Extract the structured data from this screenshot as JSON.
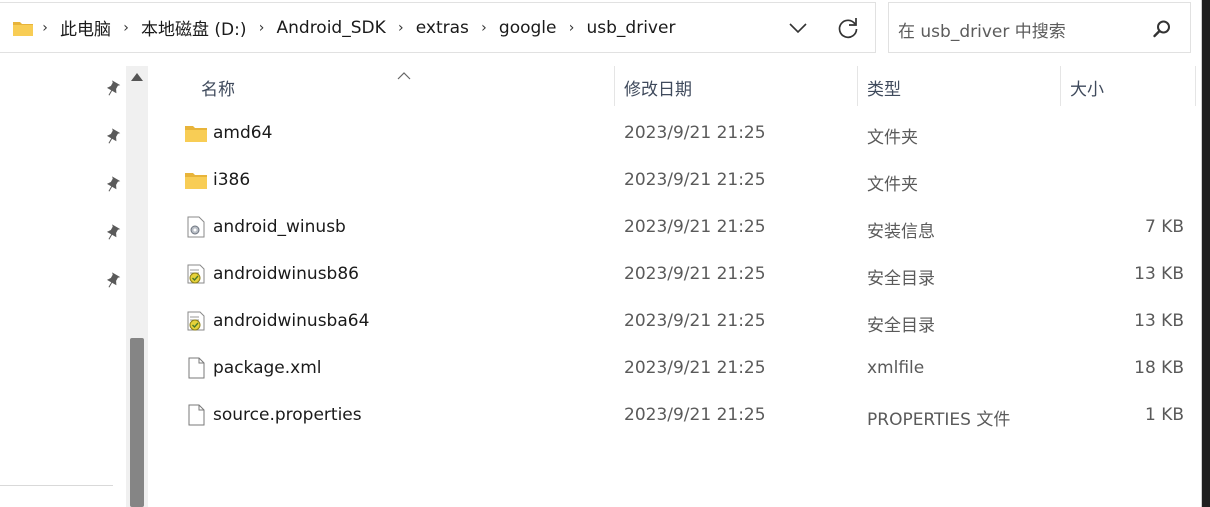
{
  "address_bar": {
    "breadcrumbs": [
      "此电脑",
      "本地磁盘 (D:)",
      "Android_SDK",
      "extras",
      "google",
      "usb_driver"
    ],
    "separator": "›"
  },
  "search": {
    "placeholder": "在 usb_driver 中搜索"
  },
  "columns": {
    "name": "名称",
    "modified": "修改日期",
    "type": "类型",
    "size": "大小"
  },
  "files": [
    {
      "name": "amd64",
      "modified": "2023/9/21 21:25",
      "type": "文件夹",
      "size": "",
      "icon": "folder-icon"
    },
    {
      "name": "i386",
      "modified": "2023/9/21 21:25",
      "type": "文件夹",
      "size": "",
      "icon": "folder-icon"
    },
    {
      "name": "android_winusb",
      "modified": "2023/9/21 21:25",
      "type": "安装信息",
      "size": "7 KB",
      "icon": "setup-info-icon"
    },
    {
      "name": "androidwinusb86",
      "modified": "2023/9/21 21:25",
      "type": "安全目录",
      "size": "13 KB",
      "icon": "security-catalog-icon"
    },
    {
      "name": "androidwinusba64",
      "modified": "2023/9/21 21:25",
      "type": "安全目录",
      "size": "13 KB",
      "icon": "security-catalog-icon"
    },
    {
      "name": "package.xml",
      "modified": "2023/9/21 21:25",
      "type": "xmlfile",
      "size": "18 KB",
      "icon": "document-icon"
    },
    {
      "name": "source.properties",
      "modified": "2023/9/21 21:25",
      "type": "PROPERTIES 文件",
      "size": "1 KB",
      "icon": "document-icon"
    }
  ],
  "colors": {
    "folder": "#f8c94a",
    "header_text": "#3f4a5c",
    "scroll_thumb": "#858585"
  }
}
